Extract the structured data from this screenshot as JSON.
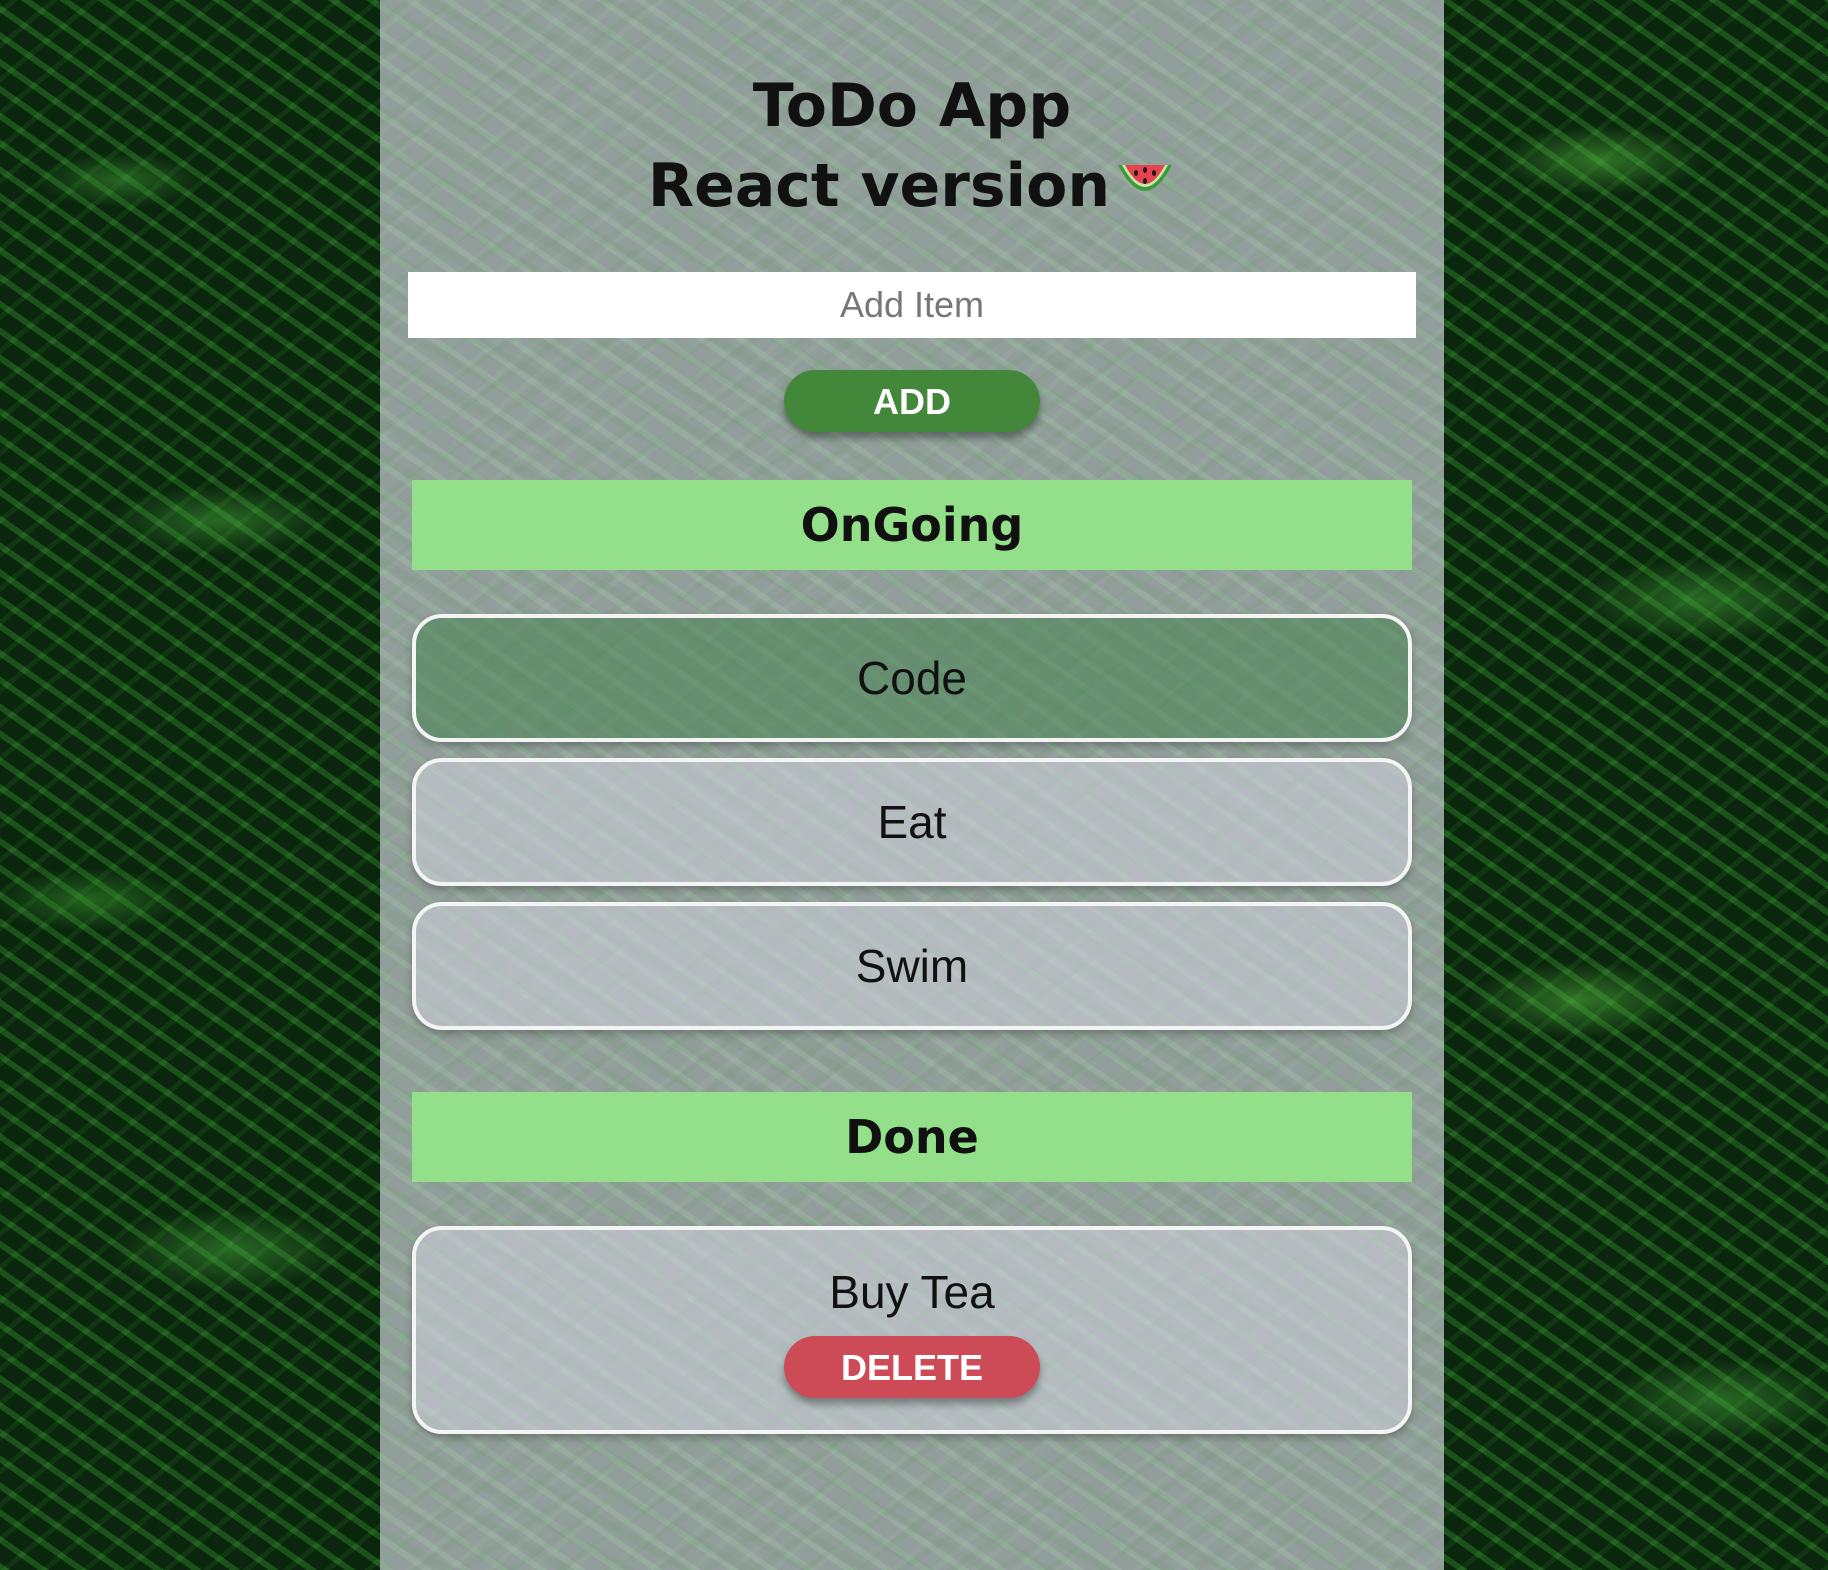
{
  "app": {
    "title_line1": "ToDo App",
    "title_line2": "React version",
    "title_emoji": "watermelon-icon"
  },
  "input": {
    "placeholder": "Add Item",
    "value": ""
  },
  "buttons": {
    "add_label": "ADD",
    "delete_label": "DELETE"
  },
  "sections": {
    "ongoing": {
      "title": "OnGoing",
      "items": [
        {
          "label": "Code"
        },
        {
          "label": "Eat"
        },
        {
          "label": "Swim"
        }
      ]
    },
    "done": {
      "title": "Done",
      "items": [
        {
          "label": "Buy Tea"
        }
      ]
    }
  },
  "colors": {
    "add_button": "#43883a",
    "delete_button": "#cd4a57",
    "section_header": "#94e08a",
    "panel": "rgba(200,205,210,0.72)"
  }
}
